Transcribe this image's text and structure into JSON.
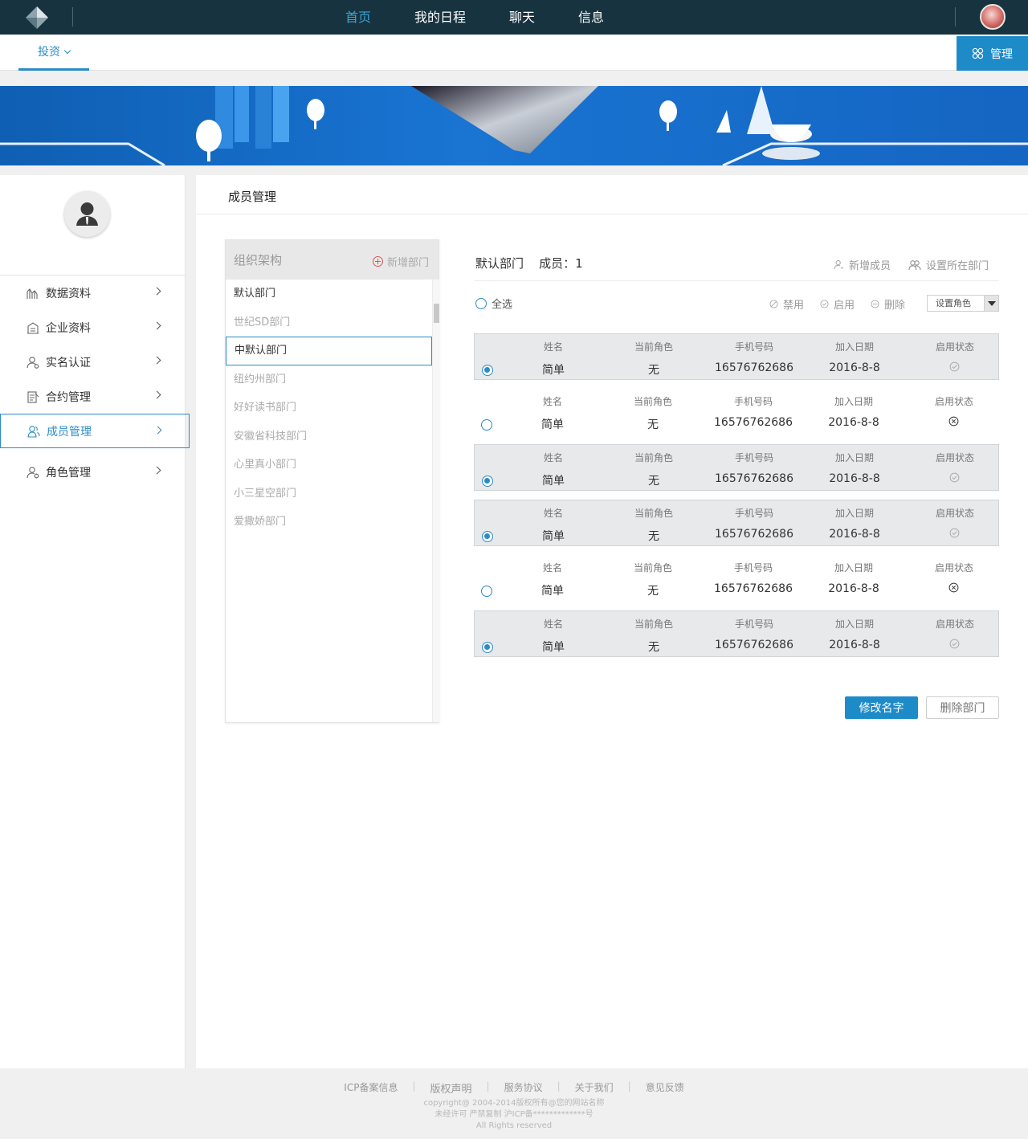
{
  "nav": {
    "items": [
      {
        "label": "首页",
        "active": true
      },
      {
        "label": "我的日程",
        "active": false
      },
      {
        "label": "聊天",
        "active": false
      },
      {
        "label": "信息",
        "active": false
      }
    ]
  },
  "subbar": {
    "invest_label": "投资",
    "manage_label": "管理"
  },
  "sidebar": {
    "items": [
      {
        "label": "数据资料",
        "icon": "chart-icon"
      },
      {
        "label": "企业资料",
        "icon": "building-icon"
      },
      {
        "label": "实名认证",
        "icon": "user-verify-icon"
      },
      {
        "label": "合约管理",
        "icon": "contract-icon"
      },
      {
        "label": "成员管理",
        "icon": "members-icon"
      },
      {
        "label": "角色管理",
        "icon": "role-icon"
      }
    ]
  },
  "main": {
    "title": "成员管理"
  },
  "org": {
    "title": "组织架构",
    "add_label": "新增部门",
    "departments": [
      "默认部门",
      "世纪SD部门",
      "中默认部门",
      "纽约州部门",
      "好好读书部门",
      "安徽省科技部门",
      "心里真小部门",
      "小三星空部门",
      "爱撒娇部门"
    ]
  },
  "dept": {
    "name": "默认部门",
    "members_text": "成员：1",
    "add_member": "新增成员",
    "set_dept": "设置所在部门",
    "select_all": "全选",
    "disable": "禁用",
    "enable": "启用",
    "delete": "删除",
    "set_role": "设置角色",
    "rename_button": "修改名字",
    "delete_button": "删除部门"
  },
  "columns": [
    "姓名",
    "当前角色",
    "手机号码",
    "加入日期",
    "启用状态"
  ],
  "members": [
    {
      "name": "简单",
      "role": "无",
      "phone": "16576762686",
      "date": "2016-8-8",
      "enabled": true,
      "selected": true
    },
    {
      "name": "简单",
      "role": "无",
      "phone": "16576762686",
      "date": "2016-8-8",
      "enabled": false,
      "selected": false
    },
    {
      "name": "简单",
      "role": "无",
      "phone": "16576762686",
      "date": "2016-8-8",
      "enabled": true,
      "selected": true
    },
    {
      "name": "简单",
      "role": "无",
      "phone": "16576762686",
      "date": "2016-8-8",
      "enabled": true,
      "selected": true
    },
    {
      "name": "简单",
      "role": "无",
      "phone": "16576762686",
      "date": "2016-8-8",
      "enabled": false,
      "selected": false
    },
    {
      "name": "简单",
      "role": "无",
      "phone": "16576762686",
      "date": "2016-8-8",
      "enabled": true,
      "selected": true
    }
  ],
  "footer": {
    "links": [
      "ICP备案信息",
      "版权声明",
      "服务协议",
      "关于我们",
      "意见反馈"
    ],
    "copy1": "copyright@ 2004-2014版权所有@您的网站名称",
    "copy2": "未经许可 严禁复制 沪ICP备*************号",
    "copy3": "All Rights reserved"
  },
  "colors": {
    "nav_bg": "#17333f",
    "accent": "#1e8bc9",
    "active_nav": "#38a6d8"
  }
}
